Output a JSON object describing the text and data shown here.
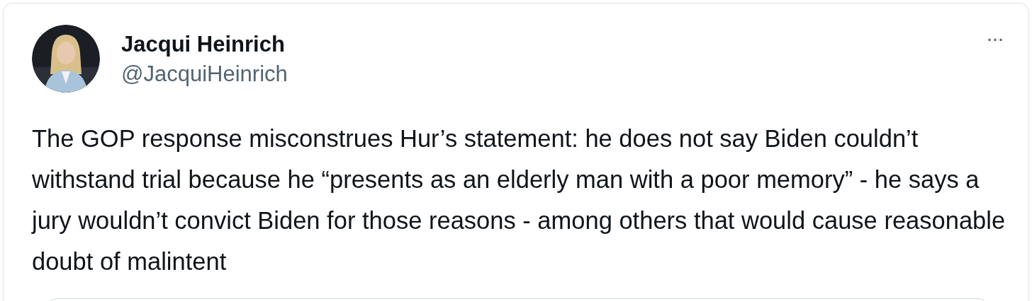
{
  "tweet": {
    "author_name": "Jacqui Heinrich",
    "handle": "@JacquiHeinrich",
    "more_button": "···",
    "text": "The GOP response misconstrues Hur’s statement: he does not say Biden couldn’t withstand trial because he “presents as an elderly man with a poor memory” - he says a jury wouldn’t convict Biden for those reasons - among others that would cause reasonable doubt of malintent",
    "quoted_card": {
      "kind": "card"
    }
  }
}
